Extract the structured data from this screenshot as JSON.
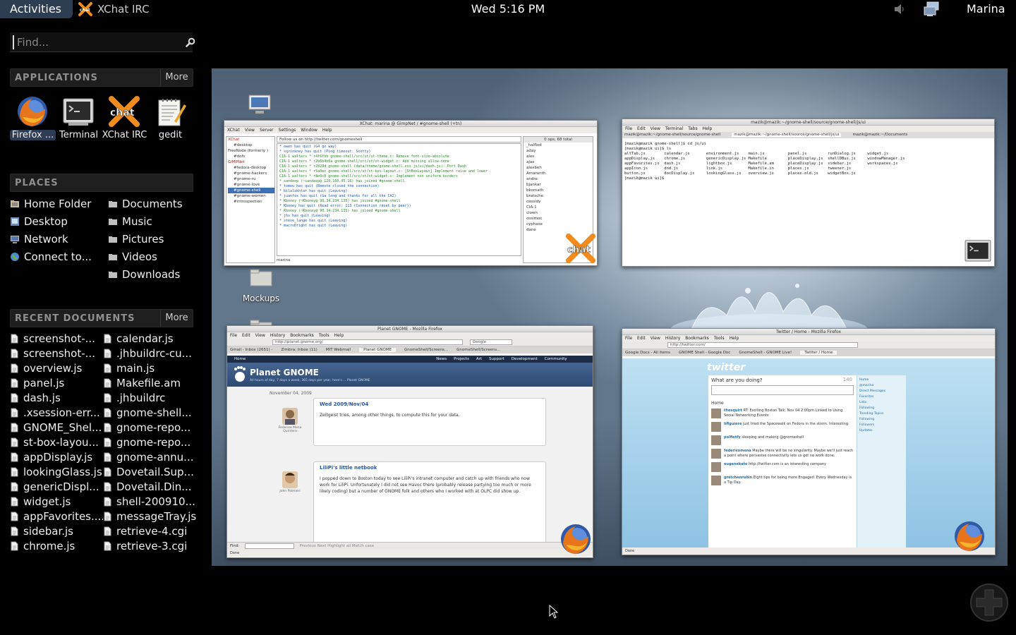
{
  "top_panel": {
    "activities_label": "Activities",
    "app_menu_label": "XChat IRC",
    "clock": "Wed  5:16 PM",
    "user_name": "Marina"
  },
  "search": {
    "placeholder": "Find..."
  },
  "applications": {
    "header": "APPLICATIONS",
    "more_label": "More",
    "items": [
      {
        "label": "Firefox ...",
        "icon": "firefox-icon"
      },
      {
        "label": "Terminal",
        "icon": "terminal-icon"
      },
      {
        "label": "XChat IRC",
        "icon": "xchat-icon"
      },
      {
        "label": "gedit",
        "icon": "gedit-icon"
      }
    ]
  },
  "places": {
    "header": "PLACES",
    "left": [
      {
        "label": "Home Folder",
        "icon": "home-folder-icon"
      },
      {
        "label": "Desktop",
        "icon": "desktop-icon"
      },
      {
        "label": "Network",
        "icon": "network-icon"
      },
      {
        "label": "Connect to...",
        "icon": "connect-icon"
      }
    ],
    "right": [
      {
        "label": "Documents",
        "icon": "folder-icon"
      },
      {
        "label": "Music",
        "icon": "folder-icon"
      },
      {
        "label": "Pictures",
        "icon": "folder-icon"
      },
      {
        "label": "Videos",
        "icon": "folder-icon"
      },
      {
        "label": "Downloads",
        "icon": "folder-icon"
      }
    ]
  },
  "recent_documents": {
    "header": "RECENT DOCUMENTS",
    "more_label": "More",
    "left": [
      "screenshot-...",
      "screenshot-...",
      "overview.js",
      "panel.js",
      "dash.js",
      ".xsession-err...",
      "GNOME_Shel...",
      "st-box-layou...",
      "appDisplay.js",
      "lookingGlass.js",
      "genericDispl...",
      "widget.js",
      "appFavorites....",
      "sidebar.js",
      "chrome.js"
    ],
    "right": [
      "calendar.js",
      ".jhbuildrc-cu...",
      "main.js",
      "Makefile.am",
      ".jhbuildrc",
      "gnome-shell...",
      "gnome-repo...",
      "gnome-repo...",
      "gnome-annu...",
      "Dovetail.Sup...",
      "Dovetail.Din...",
      "shell-200910...",
      "messageTray.js",
      "retrieve-4.cgi",
      "retrieve-3.cgi"
    ]
  },
  "desktop_icons": [
    {
      "label": "Mockups"
    }
  ],
  "windows": {
    "xchat": {
      "title": "XChat: marina @ GimpNet / #gnome-shell (+tn)",
      "menu": [
        "XChat",
        "View",
        "Server",
        "Settings",
        "Window",
        "Help"
      ],
      "topic": "Follow us on http://twitter.com/gnomeshell",
      "user_count": "0 ops, 68 total",
      "tree": [
        "XChat",
        "#desktop",
        "FreeNode (formerly )",
        "#dofs",
        "GIMPNet",
        "#fedora-desktop",
        "#gnome-hackers",
        "#gnome-ru",
        "#gnome-love",
        "#gnome-shell",
        "#gnome-women",
        "#introspection"
      ],
      "users": [
        "_halfbot",
        "aday",
        "alex",
        "ajax",
        "alexbeh",
        "Amaranth",
        "andre",
        "bjankar",
        "bkomath",
        "bratsche",
        "cassidy",
        "CIA-1",
        "clown",
        "cosimoc",
        "cyphase",
        "dane"
      ],
      "lines": [
        "* owen has quit (G4 go way)",
        "* sqrinkney has quit (Ping timeout: Scotty)",
        "CIA-1  walters * r4f6fbb gnome-shell/src/st/st-theme.c: Remove font-size-absolute",
        "CIA-1  walters * r2b6b4b6a gnome-shell/src/st/st-widget.c: Add missing allow-none",
        "CIA-1  walters * r2828d gnome-shell (data/theme/gnome-shell.css js/ui/dash.js): Port Dash",
        "CIA-1  walters * r5a0ec gnome-shell/src/st/st-box-layout.c: [StBoxLayout] Implement raise and lower",
        "CIA-1  walters * r8e0c8 gnome-shell/src/st/st-widget.c: Implement non uniform borders",
        "* sandeep (~sandeep@ 120.160.45.16) has joined #gnome-shell",
        "* tomeu has quit (Remote closed the connection)",
        "* bilalakhtar has quit (Leaving)",
        "* juanfox has quit (Ga long and thanks for all the CAI)",
        "* Kboney (~Kboney@ 90.34.234.135) has joined #gnome-shell",
        "* Kboney has quit (Read error: 113 (Connection reset by peer))",
        "* Kboney (~Kboney@ 90.34.234.135) has joined #gnome-shell",
        "* jhs has quit (Leaving)",
        "* steve_lange has quit (Leaving)",
        "* macroDright has quit (Leaving)"
      ],
      "nick": "marina"
    },
    "terminal": {
      "title": "mazik@mazik:~/gnome-shell/source/gnome-shell/js/ui",
      "menu": [
        "File",
        "Edit",
        "View",
        "Terminal",
        "Tabs",
        "Help"
      ],
      "tabs": [
        "mazik@mazik:~/gnome-shell/source/gnome-shell",
        "mazik@mazik:~/gnome-shell/source/gnome-shell/js/ui",
        "mazik@mazik:~/Documents"
      ],
      "lines": [
        "[mazik@mazik gnome-shell]$ cd js/ui",
        "[mazik@mazik ui]$ ls",
        "altTab.js        calendar.js       environment.js    main.js          panel.js         runDialog.js     widget.js",
        "appDisplay.js    chrome.js         genericDisplay.js Makefile         placeDisplay.js  shellDBus.js     windowManager.js",
        "appFavorites.js  dash.js           lightbox.js       Makefile.am      placeDisplay.js  sidebar.js       workspaces.js",
        "appIcon.js       dnd.js            link.js           Makefile.in      places.js        tweener.js",
        "button.js        docDisplay.js     lookingGlass.js   overview.js      places-old.js    widgetBox.js",
        "[mazik@mazik ui]$ "
      ]
    },
    "planet": {
      "title": "Planet GNOME - Mozilla Firefox",
      "menu": [
        "File",
        "Edit",
        "View",
        "History",
        "Bookmarks",
        "Tools",
        "Help"
      ],
      "url": "http://planet.gnome.org/",
      "search_placeholder": "Google",
      "tabs": [
        "Gmail - Inbox (2651) -",
        "Zimbra: Inbox (11)",
        "MIT Webmail",
        "Planet GNOME",
        "GnomeShell/Screens...",
        "GnomeShell/Screens..."
      ],
      "nav": [
        "Home",
        "News",
        "Projects",
        "Art",
        "Support",
        "Development",
        "Community"
      ],
      "site_title": "Planet GNOME",
      "site_sub": "All hours of day, 7 days a week, 365 days per year, here's ... Planet GNOME",
      "date": "November 04, 2009",
      "post1_title": "Wed 2009/Nov/04",
      "post1_text": "Zeitgeist tries, among other things, to compute this for your data.",
      "post1_author": "Federico Mena Quintero",
      "post2_title": "LiliPi's little netbook",
      "post2_text": "I popped down to Boston today to see LiliPi's intranet computer and catch up with friends who now work for LiliPi. Unfortunately I did not see Havoc there (probably release partying too much or more likely coding) but a number of GNOME folk and others who I worked with at OLPC did show up.",
      "post2_author": "John Palmieri",
      "find_label": "Find:",
      "find_options": "Previous  Next  Highlight all  Match case",
      "status": "Done"
    },
    "twitter": {
      "title": "Twitter / Home - Mozilla Firefox",
      "menu": [
        "File",
        "Edit",
        "View",
        "History",
        "Bookmarks",
        "Tools",
        "Help"
      ],
      "url": "http://twitter.com/",
      "tabs": [
        "Google Docs - All items",
        "GNOME Shell - Google Doc",
        "GnomeShell - GNOME Live!",
        "Twitter / Home"
      ],
      "logo": "twitter",
      "prompt": "What are you doing?",
      "count": "140",
      "home_label": "Home",
      "tweets": [
        {
          "name": "thesquirt",
          "text": "RT: Exciting Boston Talk, Nov 04 2:00pm Linked to Using Social Networking Events"
        },
        {
          "name": "hfiguiere",
          "text": "just tried the Spacewalk on Fedora in the storm. Interesting."
        },
        {
          "name": "polfiotfy",
          "text": "sleeping and making @gnomeshell"
        },
        {
          "name": "federicomena",
          "text": "Maybe there will be no singularity. Maybe we'll just reach a point where pervasive connectivity lets us get no work done."
        },
        {
          "name": "eugenekate",
          "text": "http://twitter.com is an interesting company"
        },
        {
          "name": "gretchenrubin",
          "text": "Eight tips for being more Engaged: Every Wednesday is a Tip Day."
        }
      ],
      "side": [
        "Home",
        "@marina",
        "Direct Messages",
        "Favorites",
        "Lists",
        "Following",
        "Trending Topics",
        "Following",
        "Followers",
        "Updates"
      ],
      "status": "Done"
    }
  }
}
